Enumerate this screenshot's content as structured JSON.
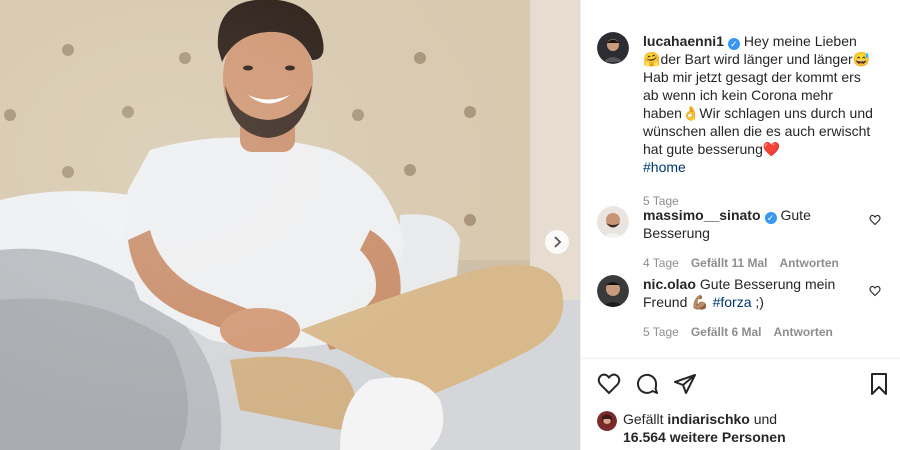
{
  "post": {
    "author": "lucahaenni1",
    "caption_p1": "Hey meine Lieben ",
    "caption_e1": "🤗",
    "caption_p2": "der Bart wird länger und länger",
    "caption_e2": "😅",
    "caption_p3": "Hab mir jetzt gesagt der kommt ers ab wenn ich kein Corona mehr haben",
    "caption_e3": "👌",
    "caption_p4": "Wir schlagen uns durch und wünschen allen die es auch erwischt hat gute besserung",
    "caption_e4": "❤️",
    "hashtag": "#home",
    "time": "5 Tage"
  },
  "comments": [
    {
      "user": "massimo__sinato",
      "text": "Gute Besserung",
      "time": "4 Tage",
      "likes": "Gefällt 11 Mal",
      "reply": "Antworten"
    },
    {
      "user": "nic.olao",
      "text": "Gute Besserung mein Freund ",
      "emoji": "💪🏽",
      "hashtag": "#forza",
      "suffix": " ;)",
      "time": "5 Tage",
      "likes": "Gefällt 6 Mal",
      "reply": "Antworten"
    }
  ],
  "likes": {
    "prefix": "Gefällt ",
    "user": "indiarischko",
    "mid": " und",
    "count": "16.564 weitere Personen"
  },
  "icons": {
    "verified": "✓",
    "like": "heart-icon",
    "comment": "comment-icon",
    "share": "share-icon",
    "save": "bookmark-icon",
    "next": "chevron-right-icon"
  }
}
